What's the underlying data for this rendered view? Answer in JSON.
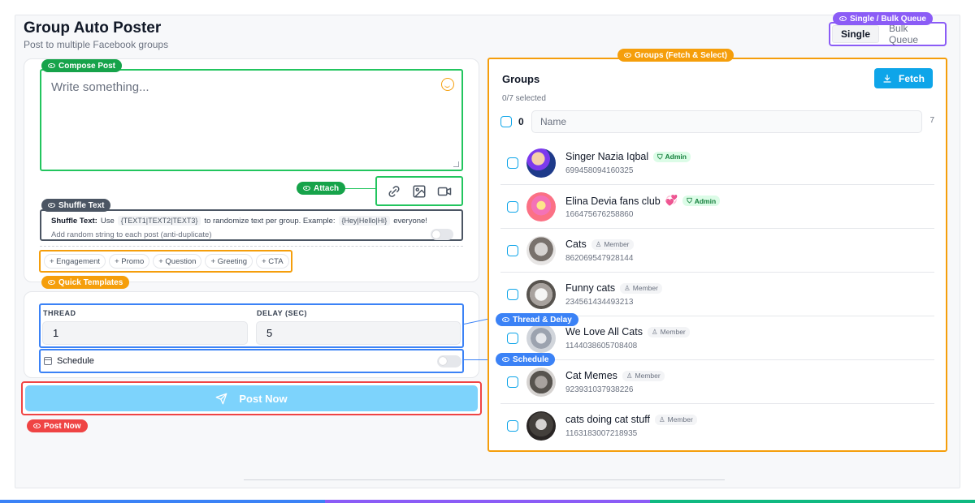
{
  "header": {
    "title": "Group Auto Poster",
    "subtitle": "Post to multiple Facebook groups"
  },
  "mode": {
    "badge": "Single / Bulk Queue",
    "single": "Single",
    "bulk": "Bulk Queue"
  },
  "compose": {
    "badge": "Compose Post",
    "placeholder": "Write something..."
  },
  "attach": {
    "badge": "Attach",
    "icons": [
      "link-icon",
      "image-icon",
      "video-icon"
    ]
  },
  "shuffle": {
    "badge": "Shuffle Text",
    "label": "Shuffle Text:",
    "use": "Use",
    "code1": "{TEXT1|TEXT2|TEXT3}",
    "mid": "to randomize text per group. Example:",
    "code2": "{Hey|Hello|Hi}",
    "end": "everyone!",
    "random_label": "Add random string to each post (anti-duplicate)"
  },
  "templates": {
    "badge": "Quick Templates",
    "chips": [
      "+ Engagement",
      "+ Promo",
      "+ Question",
      "+ Greeting",
      "+ CTA"
    ]
  },
  "thread_delay": {
    "badge": "Thread & Delay",
    "thread_label": "THREAD",
    "thread_value": "1",
    "delay_label": "DELAY (SEC)",
    "delay_value": "5"
  },
  "schedule": {
    "badge": "Schedule",
    "label": "Schedule"
  },
  "post": {
    "badge": "Post Now",
    "label": "Post Now"
  },
  "groups": {
    "badge": "Groups (Fetch & Select)",
    "title": "Groups",
    "selected": "0/7 selected",
    "fetch_label": "Fetch",
    "select_count": "0",
    "name_placeholder": "Name",
    "total": "7",
    "items": [
      {
        "name": "Singer Nazia Iqbal",
        "id": "699458094160325",
        "role": "Admin",
        "emoji": ""
      },
      {
        "name": "Elina Devia fans club",
        "id": "166475676258860",
        "role": "Admin",
        "emoji": "💞"
      },
      {
        "name": "Cats",
        "id": "862069547928144",
        "role": "Member",
        "emoji": ""
      },
      {
        "name": "Funny cats",
        "id": "234561434493213",
        "role": "Member",
        "emoji": ""
      },
      {
        "name": "We Love All Cats",
        "id": "1144038605708408",
        "role": "Member",
        "emoji": ""
      },
      {
        "name": "Cat Memes",
        "id": "923931037938226",
        "role": "Member",
        "emoji": ""
      },
      {
        "name": "cats doing cat stuff",
        "id": "1163183007218935",
        "role": "Member",
        "emoji": ""
      }
    ]
  },
  "colors": {
    "accent": "#0ea5e9",
    "post_button": "#7dd3fc",
    "green": "#22c55e",
    "orange": "#f59e0b",
    "blue": "#3b82f6",
    "red": "#ef4444",
    "purple": "#8b5cf6"
  }
}
